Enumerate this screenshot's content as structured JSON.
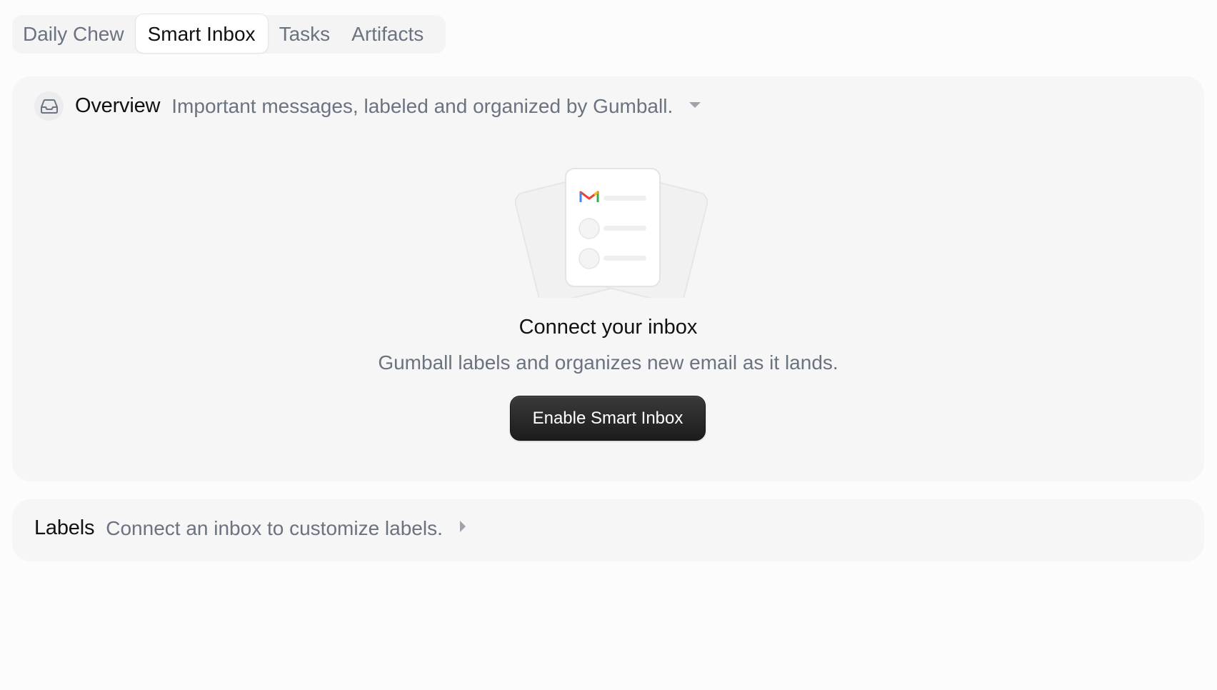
{
  "tabs": [
    {
      "label": "Daily Chew",
      "active": false
    },
    {
      "label": "Smart Inbox",
      "active": true
    },
    {
      "label": "Tasks",
      "active": false
    },
    {
      "label": "Artifacts",
      "active": false
    }
  ],
  "overview": {
    "icon": "inbox-icon",
    "title": "Overview",
    "description": "Important messages, labeled and organized by Gumball.",
    "expanded": true,
    "empty_state": {
      "illustration_icon": "gmail-icon",
      "title": "Connect your inbox",
      "description": "Gumball labels and organizes new email as it lands.",
      "button_label": "Enable Smart Inbox"
    }
  },
  "labels": {
    "title": "Labels",
    "description": "Connect an inbox to customize labels.",
    "expanded": false
  },
  "colors": {
    "background": "#fcfcfc",
    "panel": "#f6f6f7",
    "muted_text": "#6b7280",
    "primary_button": "#222222"
  }
}
